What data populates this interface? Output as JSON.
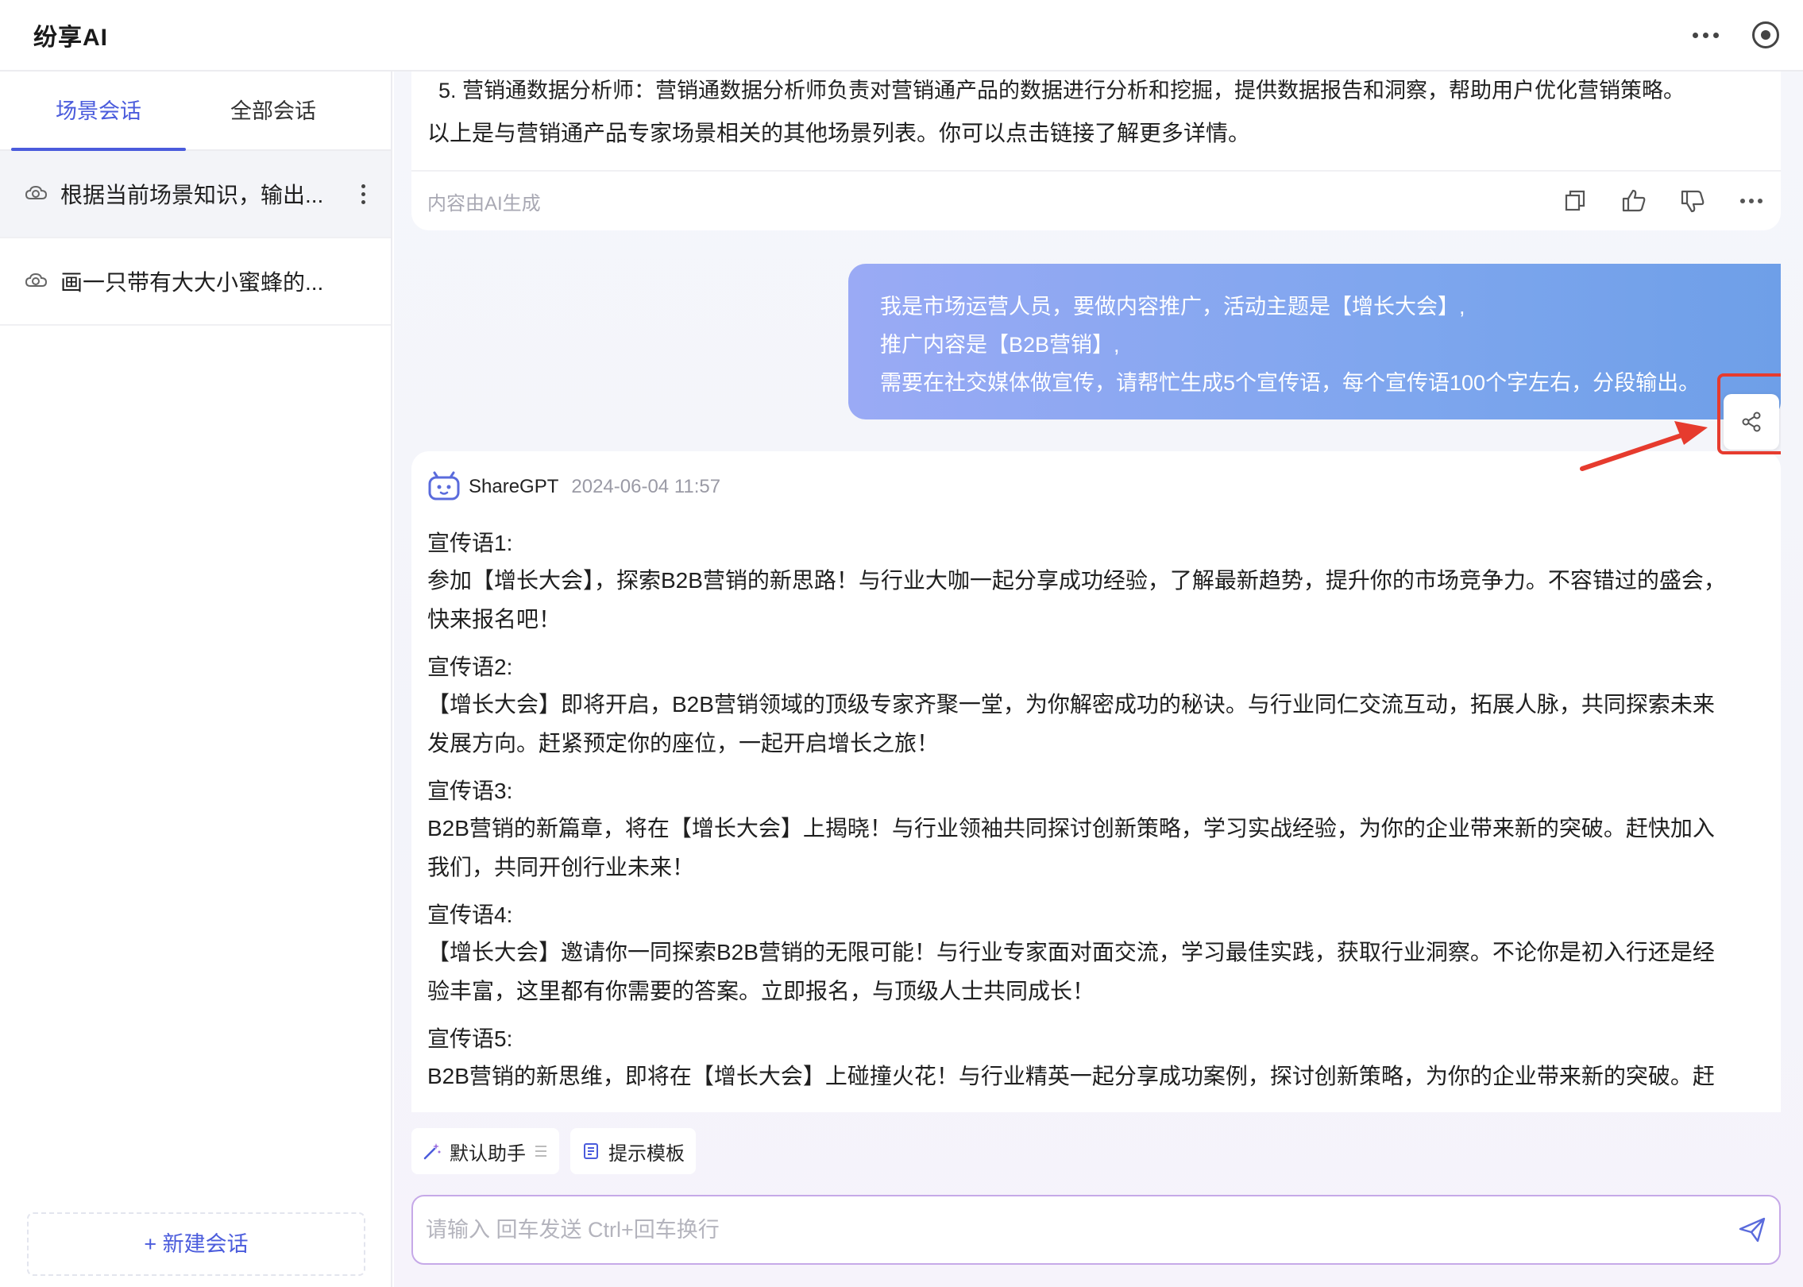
{
  "app": {
    "title": "纷享AI"
  },
  "sidebar": {
    "tabs": [
      {
        "label": "场景会话",
        "active": true
      },
      {
        "label": "全部会话",
        "active": false
      }
    ],
    "conversations": [
      {
        "title": "根据当前场景知识，输出...",
        "selected": true
      },
      {
        "title": "画一只带有大大小蜜蜂的...",
        "selected": false
      }
    ],
    "new_conversation_label": "+ 新建会话"
  },
  "chat": {
    "prev_ai": {
      "cut_line": "5. 营销通数据分析师：营销通数据分析师负责对营销通产品的数据进行分析和挖掘，提供数据报告和洞察，帮助用户优化营销策略。",
      "summary": "以上是与营销通产品专家场景相关的其他场景列表。你可以点击链接了解更多详情。",
      "ai_note": "内容由AI生成"
    },
    "user_message": {
      "lines": [
        "我是市场运营人员，要做内容推广，活动主题是【增长大会】,",
        "推广内容是【B2B营销】,",
        "需要在社交媒体做宣传，请帮忙生成5个宣传语，每个宣传语100个字左右，分段输出。"
      ]
    },
    "ai_reply": {
      "bot_name": "ShareGPT",
      "timestamp": "2024-06-04 11:57",
      "slogans": [
        {
          "title": "宣传语1:",
          "line1": "参加【增长大会】，探索B2B营销的新思路！与行业大咖一起分享成功经验，了解最新趋势，提升你的市场竞争力。不容错过的盛会，",
          "line2": "快来报名吧！"
        },
        {
          "title": "宣传语2:",
          "line1": "【增长大会】即将开启，B2B营销领域的顶级专家齐聚一堂，为你解密成功的秘诀。与行业同仁交流互动，拓展人脉，共同探索未来",
          "line2": "发展方向。赶紧预定你的座位，一起开启增长之旅！"
        },
        {
          "title": "宣传语3:",
          "line1": "B2B营销的新篇章，将在【增长大会】上揭晓！与行业领袖共同探讨创新策略，学习实战经验，为你的企业带来新的突破。赶快加入",
          "line2": "我们，共同开创行业未来！"
        },
        {
          "title": "宣传语4:",
          "line1": "【增长大会】邀请你一同探索B2B营销的无限可能！与行业专家面对面交流，学习最佳实践，获取行业洞察。不论你是初入行还是经",
          "line2": "验丰富，这里都有你需要的答案。立即报名，与顶级人士共同成长！"
        },
        {
          "title": "宣传语5:",
          "line1": "B2B营销的新思维，即将在【增长大会】上碰撞火花！与行业精英一起分享成功案例，探讨创新策略，为你的企业带来新的突破。赶",
          "line2": ""
        }
      ]
    }
  },
  "toolbar": {
    "assistant_label": "默认助手",
    "template_label": "提示模板"
  },
  "input": {
    "placeholder": "请输入 回车发送 Ctrl+回车换行"
  },
  "colors": {
    "accent": "#4a5bdc",
    "highlight": "#e63b2e",
    "bubble_start": "#9aaaf5",
    "bubble_end": "#6e9fe8"
  }
}
